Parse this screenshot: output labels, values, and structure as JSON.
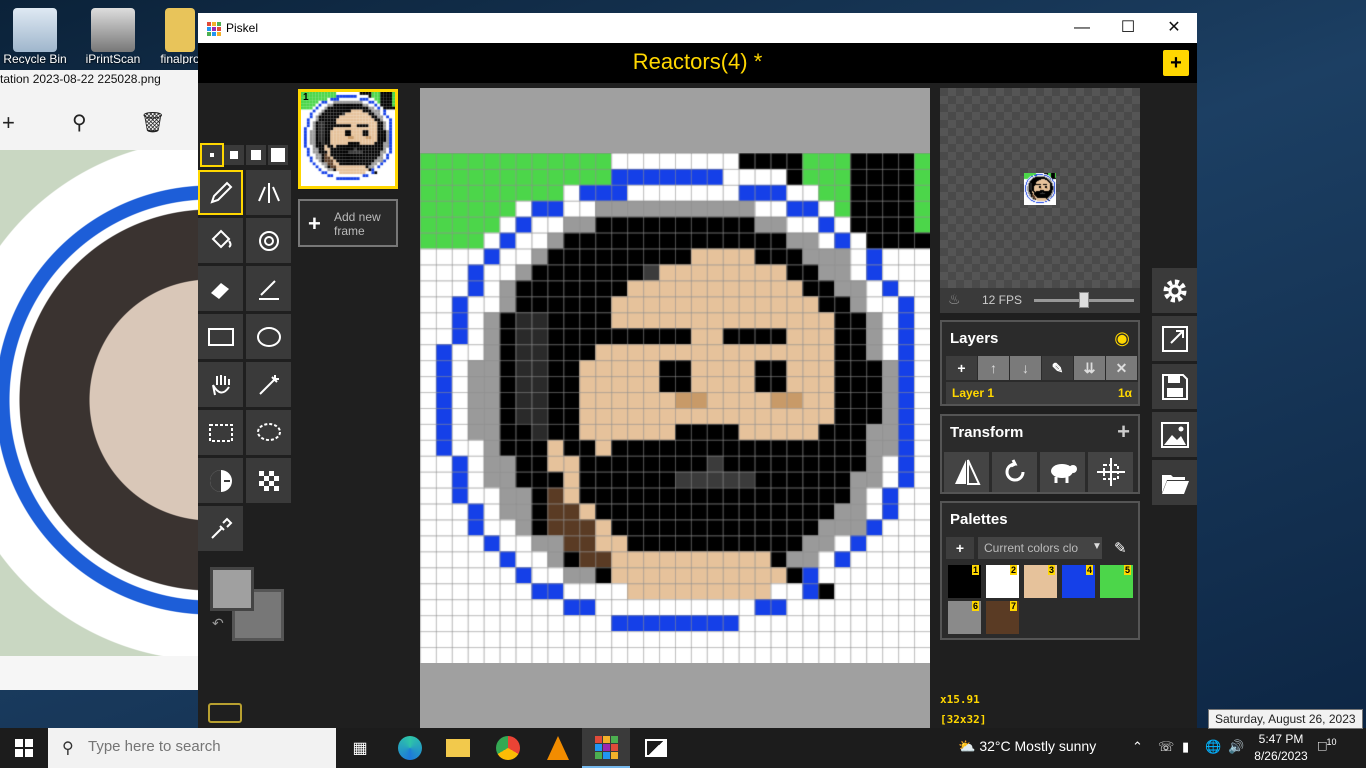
{
  "desktop": {
    "icons": [
      {
        "label": "Recycle Bin"
      },
      {
        "label": "iPrintScan"
      },
      {
        "label": "finalpro"
      }
    ]
  },
  "photo_viewer": {
    "title": "tation 2023-08-22 225028.png"
  },
  "piskel": {
    "app_name": "Piskel",
    "window_controls": {
      "minimize": "—",
      "maximize": "☐",
      "close": "✕"
    },
    "document_title": "Reactors(4) *",
    "new_button": "+",
    "frames": {
      "frame_number": "1",
      "add_frame_plus": "+",
      "add_frame_label": "Add new frame"
    },
    "zoom": "x15.91",
    "dimensions": "[32x32]",
    "preview": {
      "fps_label": "12 FPS",
      "fps_value": 12,
      "fps_max": 24
    },
    "layers": {
      "title": "Layers",
      "buttons": [
        "+",
        "↑",
        "↓",
        "✎",
        "⇊",
        "✕"
      ],
      "items": [
        {
          "name": "Layer 1",
          "alpha": "1α"
        }
      ]
    },
    "transform": {
      "title": "Transform",
      "add": "+"
    },
    "palettes": {
      "title": "Palettes",
      "add": "+",
      "selected": "Current colors clo",
      "dropdown_arrow": "▼",
      "colors": [
        {
          "num": "1",
          "hex": "#000000"
        },
        {
          "num": "2",
          "hex": "#ffffff"
        },
        {
          "num": "3",
          "hex": "#e6c29b"
        },
        {
          "num": "4",
          "hex": "#1540e8"
        },
        {
          "num": "5",
          "hex": "#4cd64a"
        },
        {
          "num": "6",
          "hex": "#8a8a8a"
        },
        {
          "num": "7",
          "hex": "#5a3b24"
        }
      ]
    },
    "primary_color": "#a0a0a0",
    "secondary_color": "#777777",
    "accent": "#ffd700"
  },
  "pixel_art": {
    "size": 32,
    "palette": {
      "W": "#ffffff",
      "K": "#000000",
      "S": "#e6c29b",
      "B": "#1540e8",
      "G": "#4cd64a",
      "g": "#9a9a9a",
      "D": "#2a2a2a",
      "d": "#3b3b3b",
      "N": "#5a3b24",
      "T": "#c89a68"
    },
    "rows": [
      "GGGGGGGGGGGGWWWWWWWWKKKKGGGKKKKG",
      "GGGGGGGGGGGGBBBBBBBWWWWKGGGKKKKG",
      "GGGGGGGGGWBBBWWWWWWWBBBWWGGKKKKG",
      "GGGGGGWBBWWggggggggggWWBBWGKKKKG",
      "GGGGGWBWWggKKKKKKKKKKggWWBWKKKKG",
      "GGGGWBWWgKKKKKKKKKKKKKKggWBWKKKK",
      "WWWWBWWgKKKKKKKKKSSSSKKKgggWBWWW",
      "WWWBWWgKKKKKKKdSSSSSSSSKKggWBWWW",
      "WWWBWgKKKKKKKSSSSSSSSSSSKKggWBWW",
      "WWBWWgKKKKKKSSSSSSSSSSSSSKKgWWBW",
      "WWBWgKDDKKKKSSSSSSSSSSSSSSKKgWBW",
      "WWBWgKDDKKKKKKKKKSSKKKKSSSKKgWBW",
      "WBWWgKDDKKKSSSSSSSSSSSSSSSKKgWBW",
      "WBWggKDDKKSSSSSKKSSSSKKSSSKKKgBW",
      "WBWggKDDKKSSSSSKKSSSSKKSSSKKKgBW",
      "WBWggKDDKKSSSSSSTTSSSSTTSSKKKgBW",
      "WBWggKDDKKSSSSSSSSSSSSSSSSKKKgBW",
      "WBWggKKDKKSSSSSSKKKKSSSSSKKKggBW",
      "WBWWgKKKSKKSKKKKKKKKKKKKKKKKggBW",
      "WWBWggKKSSKKKKKKKKdKKKKKKKKKgWBW",
      "WWBWggKKKSKKKKKKdddddKKKKKKggWBW",
      "WWBWWggKNSKKKKKKKKKKKKKKKKKgWBWW",
      "WWWBWggKNNSKKKKKKKKKKKKKKKggWBWW",
      "WWWBWWgKNNNSKKKKKKKKKKKKKgggBWWW",
      "WWWWBWWggNNSSKKKKKKKKKKKggWBWWWW",
      "WWWWWBWWgKNNSSSSSSSSSSKggWBWWWWW",
      "WWWWWWBWWggKSSSSSSSSSSSKBWWWWWWW",
      "WWWWWWWBBWWWWSSSSSSSSSWWBKWWWWWW",
      "WWWWWWWWWBBWWWWWWWWWWBBWWWWWWWWW",
      "WWWWWWWWWWWWBBBBBBBBWWWWWWWWWWWW",
      "WWWWWWWWWWWWWWWWWWWWWWWWWWWWWWWW",
      "WWWWWWWWWWWWWWWWWWWWWWWWWWWWWWWW"
    ]
  },
  "taskbar": {
    "search_placeholder": "Type here to search",
    "weather": "32°C  Mostly sunny",
    "time": "5:47 PM",
    "date": "8/26/2023",
    "notifications": "10",
    "tooltip": "Saturday, August 26, 2023"
  }
}
